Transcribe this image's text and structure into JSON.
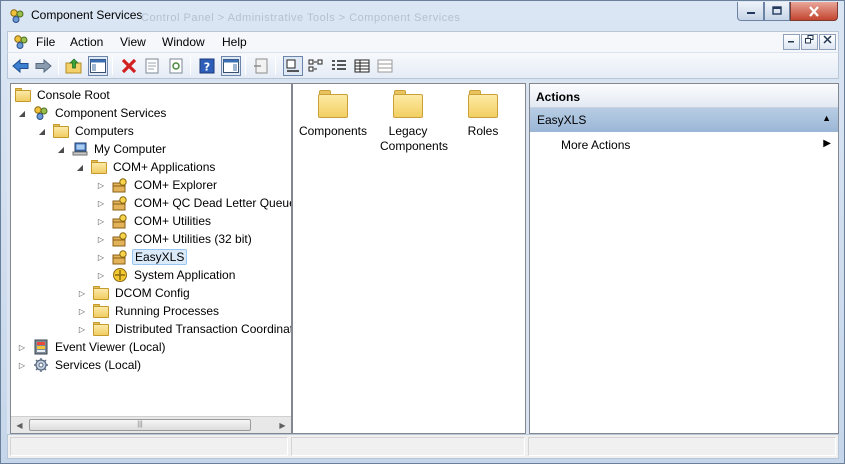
{
  "window": {
    "title": "Component Services",
    "ghost_breadcrumb": "Control Panel > Administrative Tools > Component Services"
  },
  "menu": [
    "File",
    "Action",
    "View",
    "Window",
    "Help"
  ],
  "tree": {
    "items": [
      {
        "label": "Console Root",
        "icon": "folder-icon",
        "expander": ""
      },
      {
        "label": "Component Services",
        "icon": "component-services-icon",
        "expander": "expanded"
      },
      {
        "label": "Computers",
        "icon": "folder-icon",
        "expander": "expanded"
      },
      {
        "label": "My Computer",
        "icon": "computer-icon",
        "expander": "expanded"
      },
      {
        "label": "COM+ Applications",
        "icon": "folder-icon",
        "expander": "expanded"
      },
      {
        "label": "COM+ Explorer",
        "icon": "com-package-icon",
        "expander": "collapsed"
      },
      {
        "label": "COM+ QC Dead Letter Queue",
        "icon": "com-package-icon",
        "expander": "collapsed"
      },
      {
        "label": "COM+ Utilities",
        "icon": "com-package-icon",
        "expander": "collapsed"
      },
      {
        "label": "COM+ Utilities (32 bit)",
        "icon": "com-package-icon",
        "expander": "collapsed"
      },
      {
        "label": "EasyXLS",
        "icon": "com-package-icon",
        "expander": "collapsed",
        "selected": true
      },
      {
        "label": "System Application",
        "icon": "system-application-icon",
        "expander": "collapsed"
      },
      {
        "label": "DCOM Config",
        "icon": "folder-icon",
        "expander": "collapsed"
      },
      {
        "label": "Running Processes",
        "icon": "folder-icon",
        "expander": "collapsed"
      },
      {
        "label": "Distributed Transaction Coordinator",
        "icon": "folder-icon",
        "expander": "collapsed"
      },
      {
        "label": "Event Viewer (Local)",
        "icon": "event-viewer-icon",
        "expander": "collapsed"
      },
      {
        "label": "Services (Local)",
        "icon": "services-icon",
        "expander": "collapsed"
      }
    ]
  },
  "content": {
    "items": [
      {
        "label": "Components"
      },
      {
        "label": "Legacy Components"
      },
      {
        "label": "Roles"
      }
    ]
  },
  "actions": {
    "header": "Actions",
    "group": "EasyXLS",
    "items": [
      {
        "label": "More Actions"
      }
    ]
  }
}
